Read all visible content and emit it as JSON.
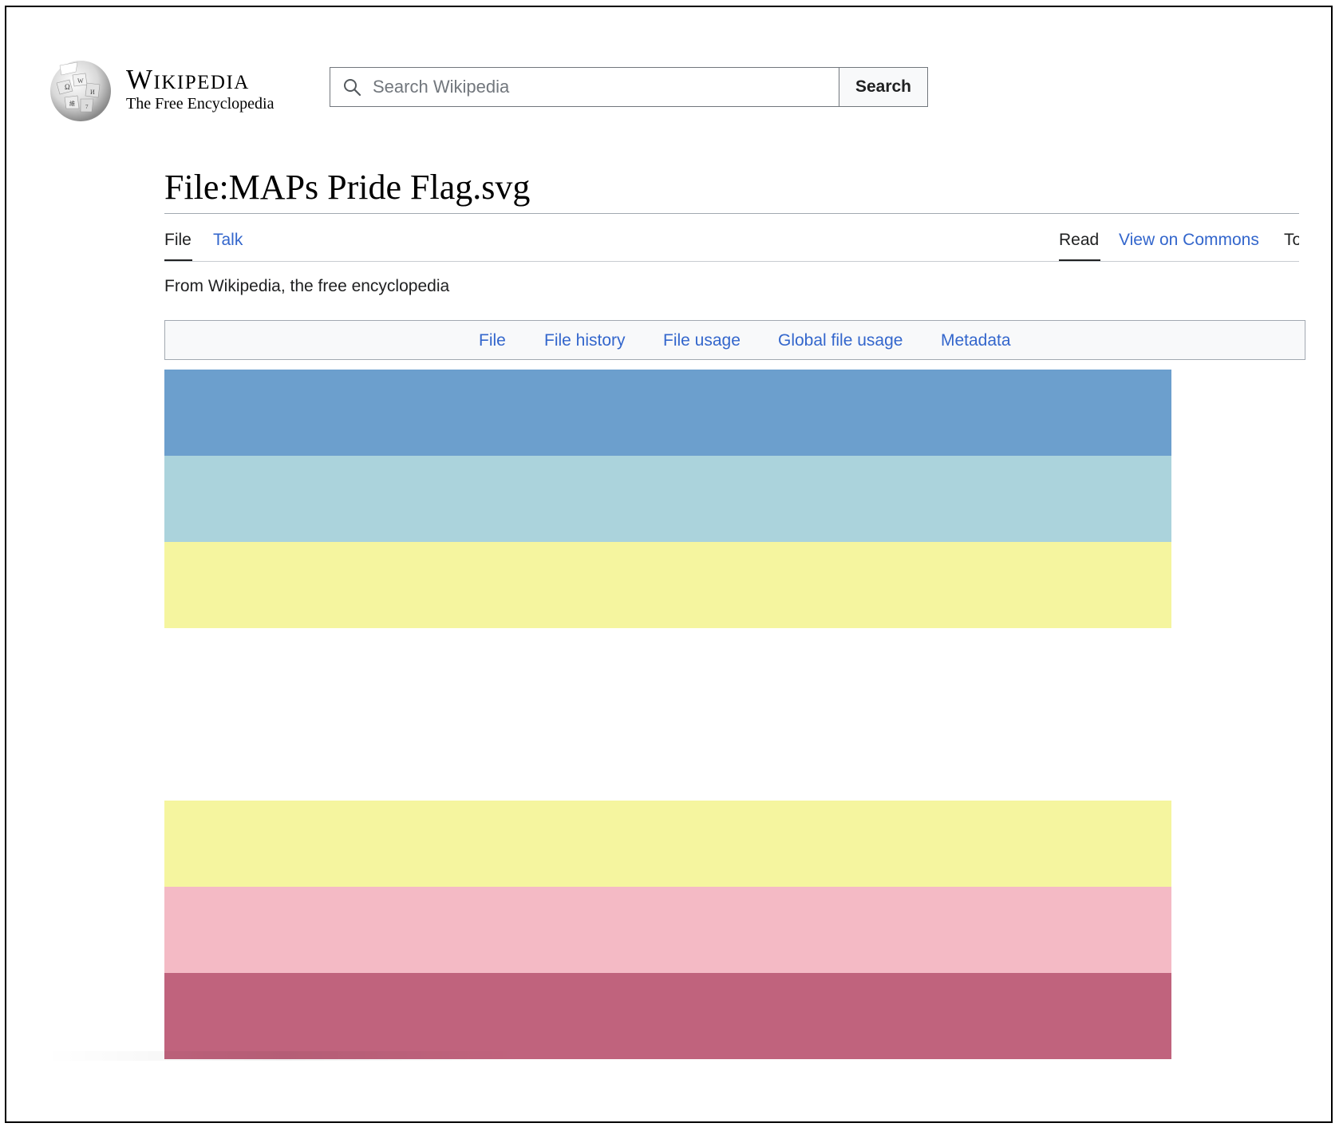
{
  "header": {
    "wordmark_title": "Wikipedia",
    "wordmark_tagline": "The Free Encyclopedia",
    "search_placeholder": "Search Wikipedia",
    "search_button": "Search"
  },
  "page": {
    "title": "File:MAPs Pride Flag.svg",
    "tagline": "From Wikipedia, the free encyclopedia"
  },
  "tabs": {
    "left": [
      {
        "label": "File",
        "active": true
      },
      {
        "label": "Talk",
        "active": false
      }
    ],
    "right": [
      {
        "label": "Read",
        "active": true
      },
      {
        "label": "View on Commons",
        "active": false
      },
      {
        "label": "Tools",
        "active": false
      }
    ]
  },
  "file_nav": {
    "items": [
      "File",
      "File history",
      "File usage",
      "Global file usage",
      "Metadata"
    ]
  },
  "flag": {
    "stripe_colors": [
      "#6c9fcd",
      "#abd3dc",
      "#f5f59f",
      "#ffffff",
      "#ffffff",
      "#f5f59f",
      "#f4bac5",
      "#c0637d"
    ]
  },
  "colors": {
    "link": "#3366cc",
    "text": "#202122"
  }
}
